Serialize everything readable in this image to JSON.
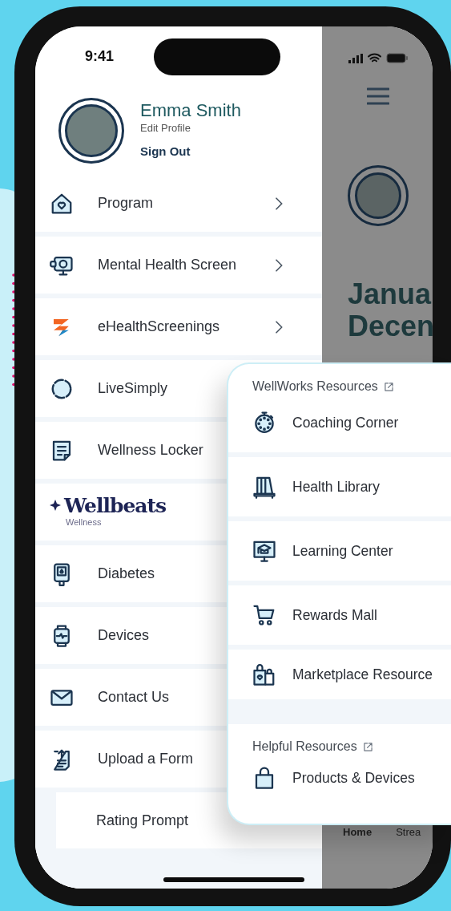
{
  "status_bar": {
    "time": "9:41"
  },
  "profile": {
    "name": "Emma Smith",
    "edit_link": "Edit Profile",
    "sign_out": "Sign Out"
  },
  "menu": [
    {
      "kind": "item",
      "label": "Program",
      "chevron": true
    },
    {
      "kind": "item",
      "label": "Mental Health Screen",
      "chevron": true
    },
    {
      "kind": "item",
      "label": "eHealthScreenings",
      "chevron": true
    },
    {
      "kind": "item",
      "label": "LiveSimply",
      "chevron": false
    },
    {
      "kind": "item",
      "label": "Wellness Locker",
      "chevron": false
    },
    {
      "kind": "logo",
      "label": "Wellbeats",
      "sublabel": "Wellness",
      "chevron": false
    },
    {
      "kind": "item",
      "label": "Diabetes",
      "chevron": false
    },
    {
      "kind": "item",
      "label": "Devices",
      "chevron": false
    },
    {
      "kind": "item",
      "label": "Contact Us",
      "chevron": false
    },
    {
      "kind": "item",
      "label": "Upload a Form",
      "chevron": false
    },
    {
      "kind": "sub",
      "label": "Rating Prompt",
      "chevron": false
    }
  ],
  "background_screen": {
    "heading_lines": [
      "Janua",
      "Decen"
    ],
    "tabs": [
      {
        "label": "Home",
        "selected": true
      },
      {
        "label": "Strea",
        "selected": false
      }
    ]
  },
  "resources_popup": {
    "sections": [
      {
        "title": "WellWorks Resources",
        "items": [
          "Coaching Corner",
          "Health Library",
          "Learning Center",
          "Rewards Mall",
          "Marketplace Resource"
        ]
      },
      {
        "title": "Helpful Resources",
        "items": [
          "Products & Devices"
        ]
      }
    ]
  }
}
